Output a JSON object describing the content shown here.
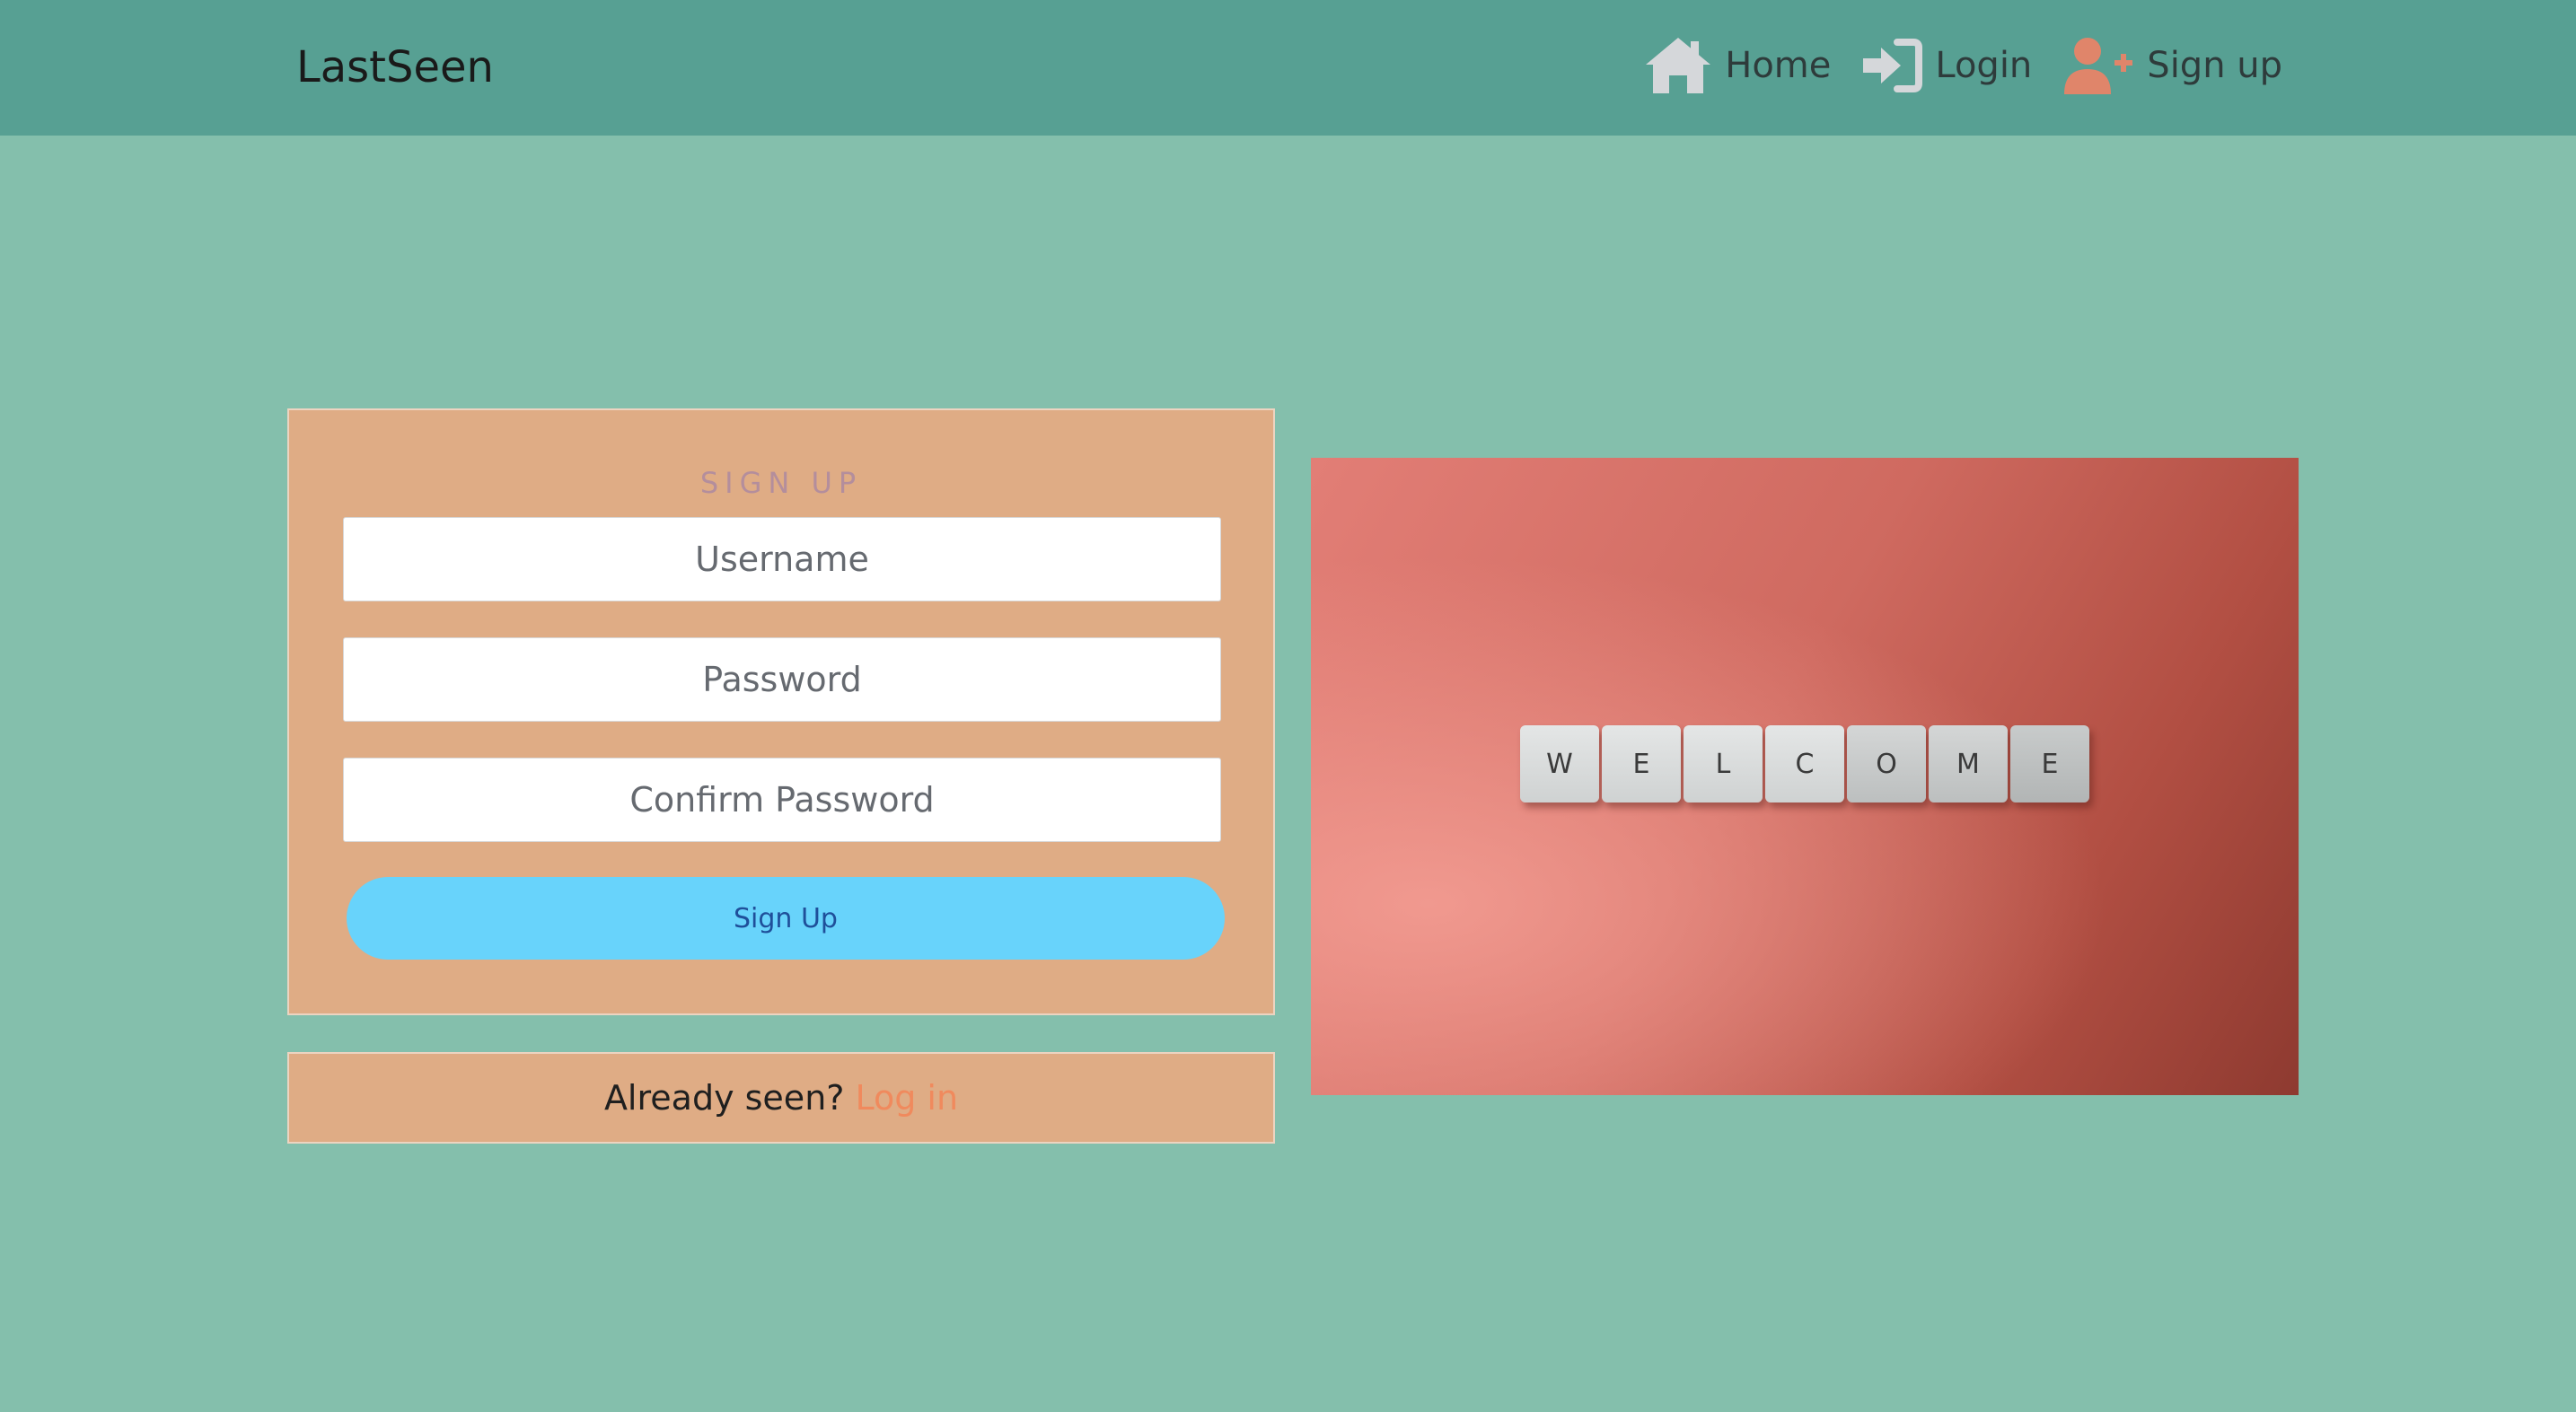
{
  "navbar": {
    "brand": "LastSeen",
    "links": [
      {
        "label": "Home",
        "icon": "home-icon"
      },
      {
        "label": "Login",
        "icon": "login-icon"
      },
      {
        "label": "Sign up",
        "icon": "user-plus-icon"
      }
    ]
  },
  "signup": {
    "title": "SIGN UP",
    "username_placeholder": "Username",
    "password_placeholder": "Password",
    "confirm_placeholder": "Confirm Password",
    "button_label": "Sign Up"
  },
  "login_prompt": {
    "text": "Already seen?",
    "link_label": "Log in"
  },
  "welcome_image": {
    "tiles": [
      "W",
      "E",
      "L",
      "C",
      "O",
      "M",
      "E"
    ]
  },
  "colors": {
    "page_bg": "#84bfac",
    "navbar_bg": "#57a093",
    "card_bg": "#dfac85",
    "button_bg": "#68d3fb",
    "link_accent": "#f08a5d",
    "signup_icon": "#e0856a"
  }
}
